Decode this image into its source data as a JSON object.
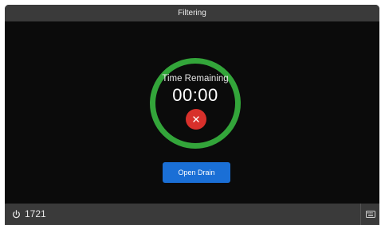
{
  "title": "Filtering",
  "timer": {
    "label": "Time Remaining",
    "value": "00:00"
  },
  "actions": {
    "open_drain_label": "Open Drain"
  },
  "status": {
    "power_value": "1721"
  },
  "icons": {
    "cancel": "close-icon",
    "power": "power-icon",
    "keyboard": "keyboard-icon"
  },
  "colors": {
    "ring": "#33a53a",
    "cancel": "#d8302b",
    "primary": "#1a6fd6",
    "bar": "#3a3a3a",
    "background": "#0b0b0b"
  }
}
